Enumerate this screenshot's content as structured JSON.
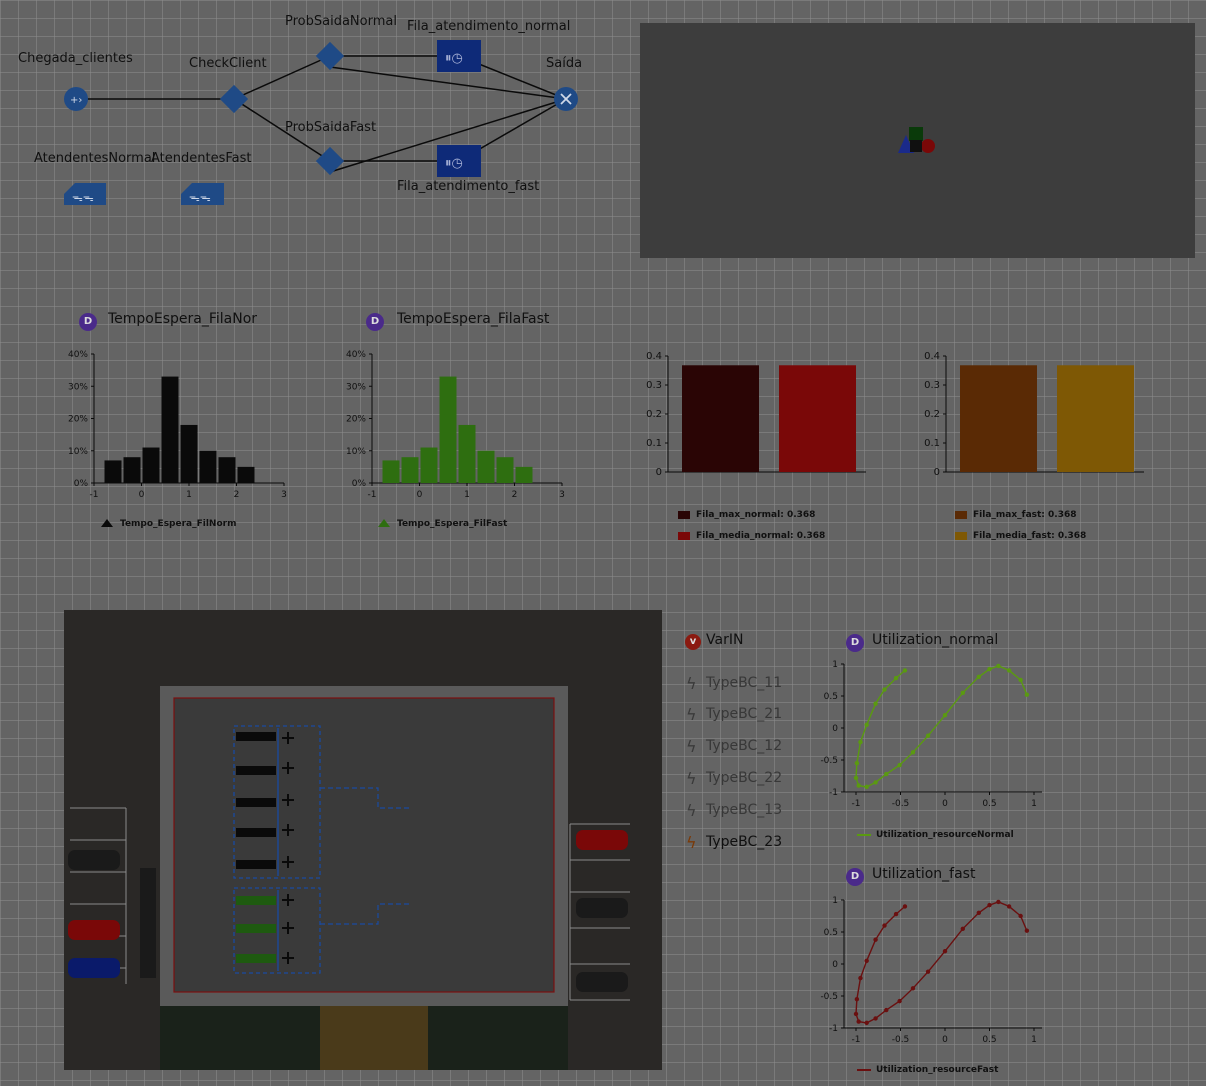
{
  "flow": {
    "chegada": "Chegada_clientes",
    "check": "CheckClient",
    "prob_normal": "ProbSaidaNormal",
    "prob_fast": "ProbSaidaFast",
    "fila_normal": "Fila_atendimento_normal",
    "fila_fast": "Fila_atendimento_fast",
    "saida": "Saída",
    "atend_normal": "AtendentesNormal",
    "atend_fast": "AtendentesFast"
  },
  "histograms": [
    {
      "title": "TempoEspera_FilaNor",
      "legend": "Tempo_Espera_FilNorm"
    },
    {
      "title": "TempoEspera_FilaFast",
      "legend": "Tempo_Espera_FilFast"
    }
  ],
  "bar_legends": {
    "max_normal": "Fila_max_normal: 0.368",
    "media_normal": "Fila_media_normal: 0.368",
    "max_fast": "Fila_max_fast: 0.368",
    "media_fast": "Fila_media_fast: 0.368"
  },
  "vars": {
    "varin": "VarIN",
    "items": [
      "TypeBC_11",
      "TypeBC_21",
      "TypeBC_12",
      "TypeBC_22",
      "TypeBC_13",
      "TypeBC_23"
    ]
  },
  "plots": {
    "normal_title": "Utilization_normal",
    "normal_legend": "Utilization_resourceNormal",
    "fast_title": "Utilization_fast",
    "fast_legend": "Utilization_resourceFast"
  },
  "chart_data": [
    {
      "type": "bar",
      "title": "TempoEspera_FilaNor",
      "series": [
        {
          "name": "Tempo_Espera_FilNorm",
          "color": "#0a0a0a",
          "values": [
            7,
            8,
            11,
            33,
            18,
            10,
            8,
            5
          ]
        }
      ],
      "bins": [
        -0.8,
        -0.4,
        0,
        0.4,
        0.8,
        1.2,
        1.6,
        2.0
      ],
      "bin_width": 0.4,
      "xlim": [
        -1,
        3
      ],
      "ylim": [
        0,
        40
      ],
      "yticks": [
        "0%",
        "10%",
        "20%",
        "30%",
        "40%"
      ],
      "xticks": [
        "-1",
        "0",
        "1",
        "2",
        "3"
      ]
    },
    {
      "type": "bar",
      "title": "TempoEspera_FilaFast",
      "series": [
        {
          "name": "Tempo_Espera_FilFast",
          "color": "#2e6e10",
          "values": [
            7,
            8,
            11,
            33,
            18,
            10,
            8,
            5
          ]
        }
      ],
      "bins": [
        -0.8,
        -0.4,
        0,
        0.4,
        0.8,
        1.2,
        1.6,
        2.0
      ],
      "bin_width": 0.4,
      "xlim": [
        -1,
        3
      ],
      "ylim": [
        0,
        40
      ],
      "yticks": [
        "0%",
        "10%",
        "20%",
        "30%",
        "40%"
      ],
      "xticks": [
        "-1",
        "0",
        "1",
        "2",
        "3"
      ]
    },
    {
      "type": "bar",
      "categories": [
        "Fila_max_normal",
        "Fila_media_normal"
      ],
      "values": [
        0.368,
        0.368
      ],
      "colors": [
        "#2a0505",
        "#7a0808"
      ],
      "ylim": [
        0,
        0.4
      ],
      "yticks": [
        "0",
        "0.1",
        "0.2",
        "0.3",
        "0.4"
      ]
    },
    {
      "type": "bar",
      "categories": [
        "Fila_max_fast",
        "Fila_media_fast"
      ],
      "values": [
        0.368,
        0.368
      ],
      "colors": [
        "#5a2a05",
        "#7e5805"
      ],
      "ylim": [
        0,
        0.4
      ],
      "yticks": [
        "0",
        "0.1",
        "0.2",
        "0.3",
        "0.4"
      ]
    },
    {
      "type": "line",
      "title": "Utilization_normal",
      "series": [
        {
          "name": "Utilization_resourceNormal",
          "color": "#5a9a10",
          "x": [
            -0.45,
            -0.55,
            -0.68,
            -0.78,
            -0.88,
            -0.95,
            -0.99,
            -1.0,
            -0.97,
            -0.88,
            -0.78,
            -0.66,
            -0.51,
            -0.36,
            -0.19,
            0.0,
            0.2,
            0.38,
            0.5,
            0.6,
            0.72,
            0.85,
            0.92
          ],
          "y": [
            0.9,
            0.78,
            0.6,
            0.38,
            0.05,
            -0.22,
            -0.55,
            -0.78,
            -0.9,
            -0.92,
            -0.85,
            -0.72,
            -0.58,
            -0.38,
            -0.12,
            0.2,
            0.55,
            0.8,
            0.92,
            0.97,
            0.9,
            0.75,
            0.52
          ]
        }
      ],
      "xlim": [
        -1,
        1
      ],
      "ylim": [
        -1,
        1
      ],
      "xticks": [
        "-1",
        "-0.5",
        "0",
        "0.5",
        "1"
      ],
      "yticks": [
        "1",
        "0.5",
        "0",
        "-0.5",
        "-1"
      ]
    },
    {
      "type": "line",
      "title": "Utilization_fast",
      "series": [
        {
          "name": "Utilization_resourceFast",
          "color": "#6a1010",
          "x": [
            -0.45,
            -0.55,
            -0.68,
            -0.78,
            -0.88,
            -0.95,
            -0.99,
            -1.0,
            -0.97,
            -0.88,
            -0.78,
            -0.66,
            -0.51,
            -0.36,
            -0.19,
            0.0,
            0.2,
            0.38,
            0.5,
            0.6,
            0.72,
            0.85,
            0.92
          ],
          "y": [
            0.9,
            0.78,
            0.6,
            0.38,
            0.05,
            -0.22,
            -0.55,
            -0.78,
            -0.9,
            -0.92,
            -0.85,
            -0.72,
            -0.58,
            -0.38,
            -0.12,
            0.2,
            0.55,
            0.8,
            0.92,
            0.97,
            0.9,
            0.75,
            0.52
          ]
        }
      ],
      "xlim": [
        -1,
        1
      ],
      "ylim": [
        -1,
        1
      ],
      "xticks": [
        "-1",
        "-0.5",
        "0",
        "0.5",
        "1"
      ],
      "yticks": [
        "1",
        "0.5",
        "0",
        "-0.5",
        "-1"
      ]
    }
  ]
}
